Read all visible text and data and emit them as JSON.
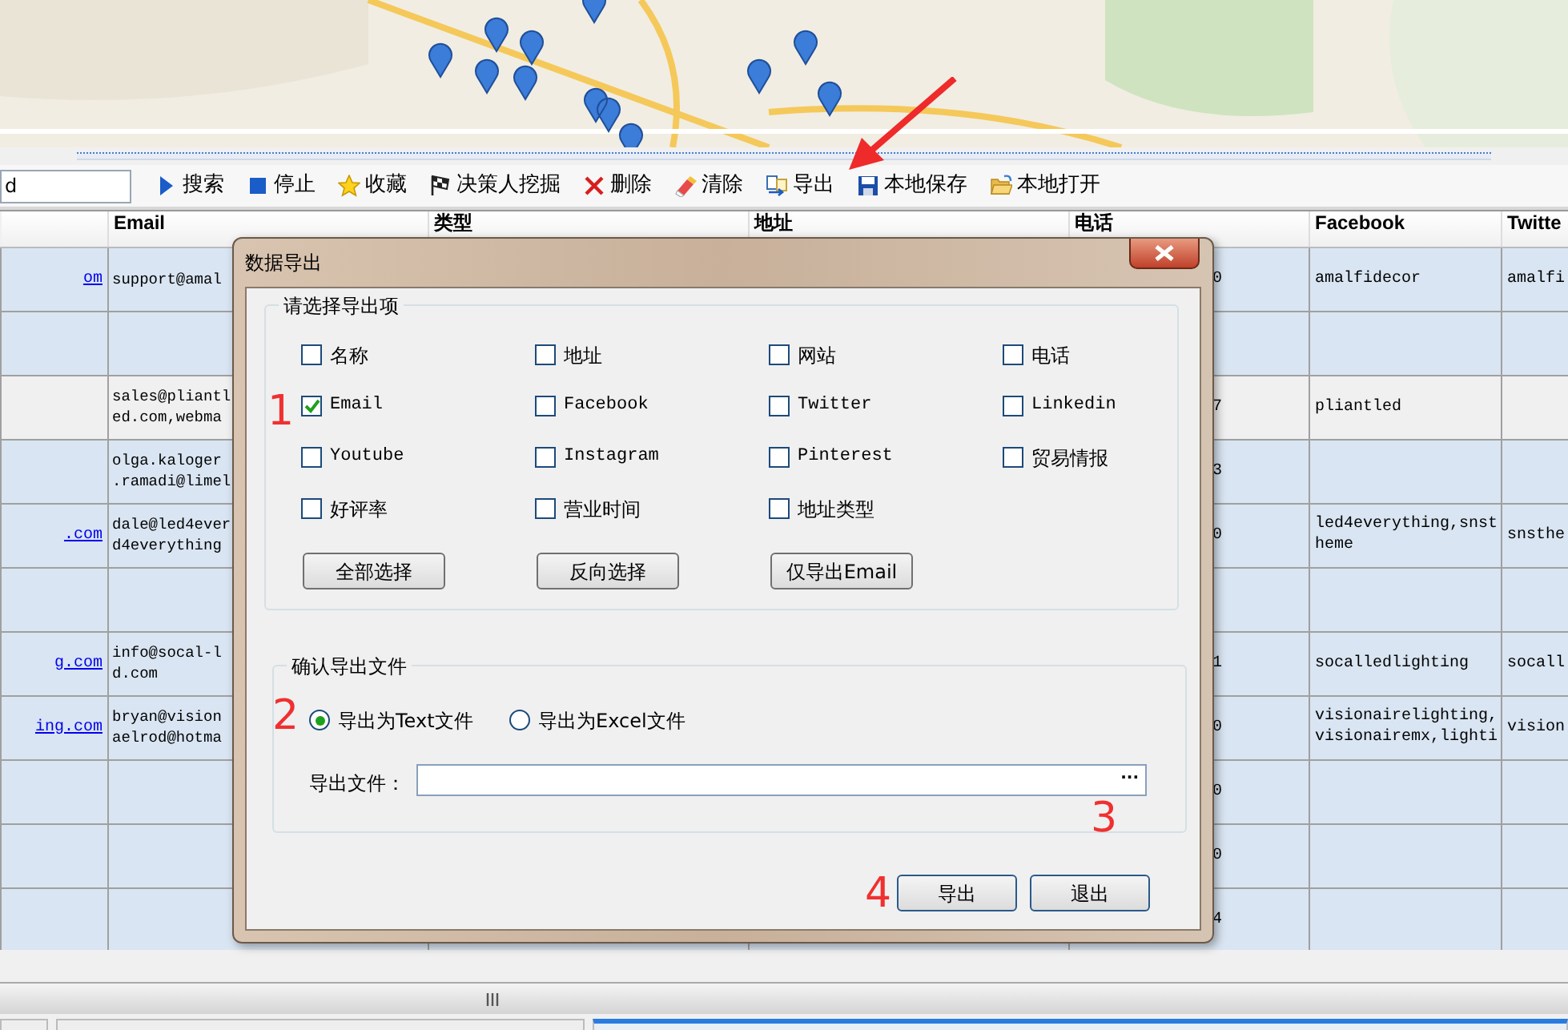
{
  "toolbar": {
    "search_value": "d",
    "buttons": [
      {
        "label": "搜索",
        "kind": "play"
      },
      {
        "label": "停止",
        "kind": "stop"
      },
      {
        "label": "收藏",
        "kind": "star"
      },
      {
        "label": "决策人挖掘",
        "kind": "flag"
      },
      {
        "label": "删除",
        "kind": "delete"
      },
      {
        "label": "清除",
        "kind": "eraser"
      },
      {
        "label": "导出",
        "kind": "export"
      },
      {
        "label": "本地保存",
        "kind": "save"
      },
      {
        "label": "本地打开",
        "kind": "open"
      }
    ]
  },
  "table": {
    "columns": [
      {
        "label": "Email"
      },
      {
        "label": "类型"
      },
      {
        "label": "地址"
      },
      {
        "label": "电话"
      },
      {
        "label": "Facebook"
      },
      {
        "label": "Twitte"
      }
    ],
    "rows": [
      {
        "selected": false,
        "link": "om",
        "email": [
          "support@amal"
        ],
        "phone": "0",
        "facebook": [
          "amalfidecor"
        ],
        "twitter": "amalfi"
      },
      {
        "selected": false
      },
      {
        "selected": true,
        "email": [
          "sales@pliantl",
          "ed.com,webma"
        ],
        "phone": "7",
        "facebook": [
          "pliantled"
        ]
      },
      {
        "selected": false,
        "email": [
          "olga.kaloger",
          ".ramadi@limel"
        ],
        "phone": "3"
      },
      {
        "selected": false,
        "link": ".com",
        "email": [
          "dale@led4ever",
          "d4everything"
        ],
        "phone": "0",
        "facebook": [
          "led4everything,snst",
          "heme"
        ],
        "twitter": "snsthe"
      },
      {
        "selected": false
      },
      {
        "selected": false,
        "link": "g.com",
        "email": [
          "info@socal-l",
          "d.com"
        ],
        "phone": "1",
        "facebook": [
          "socalledlighting"
        ],
        "twitter": "socall"
      },
      {
        "selected": false,
        "link": "ing.com",
        "email": [
          "bryan@vision",
          "aelrod@hotma"
        ],
        "phone": "0",
        "facebook": [
          "visionairelighting,",
          "visionairemx,lighti"
        ],
        "twitter": "vision"
      },
      {
        "selected": false,
        "phone": "0"
      },
      {
        "selected": false,
        "phone": "0"
      },
      {
        "selected": false,
        "phone": "4"
      }
    ]
  },
  "bottom_tabs": [
    {
      "selected": false
    },
    {
      "selected": false
    },
    {
      "selected": true
    }
  ],
  "dialog": {
    "title": "数据导出",
    "fields_group": {
      "legend": "请选择导出项",
      "options": [
        {
          "label": "名称",
          "checked": false
        },
        {
          "label": "地址",
          "checked": false
        },
        {
          "label": "网站",
          "checked": false
        },
        {
          "label": "电话",
          "checked": false
        },
        {
          "label": "Email",
          "checked": true
        },
        {
          "label": "Facebook",
          "checked": false
        },
        {
          "label": "Twitter",
          "checked": false
        },
        {
          "label": "Linkedin",
          "checked": false
        },
        {
          "label": "Youtube",
          "checked": false
        },
        {
          "label": "Instagram",
          "checked": false
        },
        {
          "label": "Pinterest",
          "checked": false
        },
        {
          "label": "贸易情报",
          "checked": false
        },
        {
          "label": "好评率",
          "checked": false
        },
        {
          "label": "营业时间",
          "checked": false
        },
        {
          "label": "地址类型",
          "checked": false
        }
      ],
      "buttons": [
        "全部选择",
        "反向选择",
        "仅导出Email"
      ]
    },
    "file_group": {
      "legend": "确认导出文件",
      "formats": [
        {
          "label": "导出为Text文件",
          "selected": true
        },
        {
          "label": "导出为Excel文件",
          "selected": false
        }
      ],
      "file_label": "导出文件：",
      "browse": "..."
    },
    "buttons": [
      "导出",
      "退出"
    ]
  },
  "annotations": [
    {
      "label": "1"
    },
    {
      "label": "2"
    },
    {
      "label": "3"
    },
    {
      "label": "4"
    }
  ]
}
